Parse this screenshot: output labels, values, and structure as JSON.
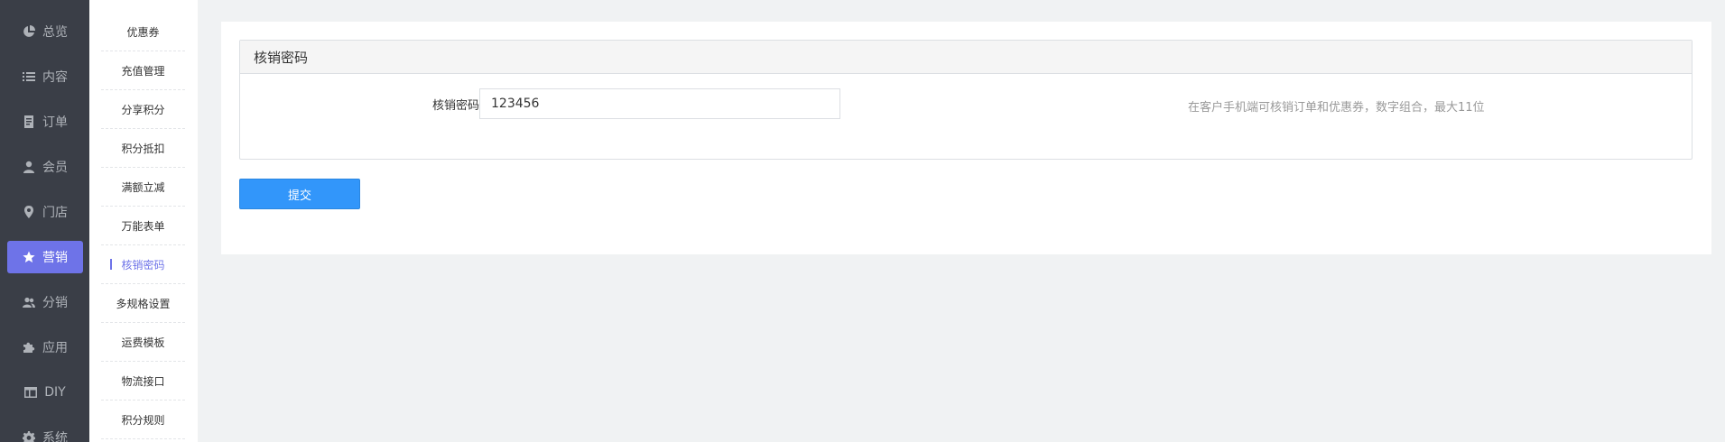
{
  "nav": {
    "items": [
      {
        "label": "总览",
        "icon": "pie-chart-icon"
      },
      {
        "label": "内容",
        "icon": "list-icon"
      },
      {
        "label": "订单",
        "icon": "document-icon"
      },
      {
        "label": "会员",
        "icon": "user-icon"
      },
      {
        "label": "门店",
        "icon": "map-pin-icon"
      },
      {
        "label": "营销",
        "icon": "star-icon",
        "active": true
      },
      {
        "label": "分销",
        "icon": "users-icon"
      },
      {
        "label": "应用",
        "icon": "puzzle-icon"
      },
      {
        "label": "DIY",
        "icon": "layout-icon"
      },
      {
        "label": "系统",
        "icon": "gear-icon"
      }
    ],
    "active_color": "#6e73e8"
  },
  "submenu": {
    "items": [
      {
        "label": "优惠券"
      },
      {
        "label": "充值管理"
      },
      {
        "label": "分享积分"
      },
      {
        "label": "积分抵扣"
      },
      {
        "label": "满额立减"
      },
      {
        "label": "万能表单"
      },
      {
        "label": "核销密码",
        "active": true
      },
      {
        "label": "多规格设置"
      },
      {
        "label": "运费模板"
      },
      {
        "label": "物流接口"
      },
      {
        "label": "积分规则"
      }
    ]
  },
  "panel": {
    "title": "核销密码",
    "field_label": "核销密码",
    "field_value": "123456",
    "hint": "在客户手机端可核销订单和优惠券，数字组合，最大11位"
  },
  "actions": {
    "submit_label": "提交",
    "submit_color": "#3296fa"
  }
}
